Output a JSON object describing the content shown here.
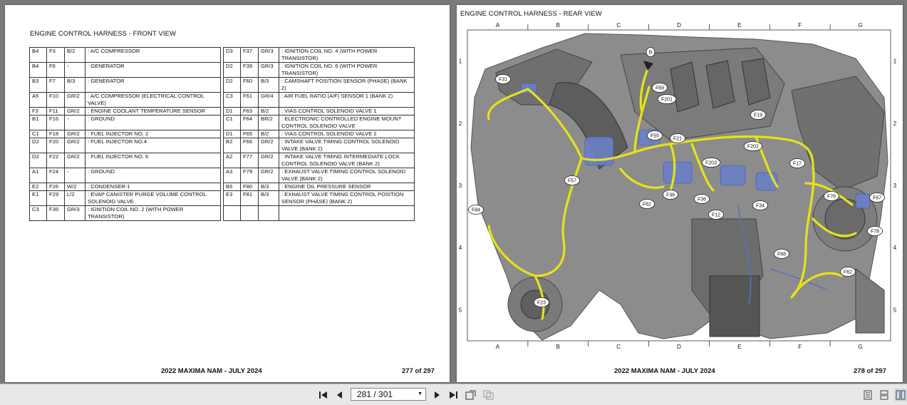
{
  "left_page": {
    "title": "ENGINE CONTROL HARNESS - FRONT VIEW",
    "footer_doc": "2022 MAXIMA NAM - JULY 2024",
    "footer_page": "277 of 297",
    "rows": [
      [
        [
          "B4",
          "F3",
          "B/2",
          ": A/C COMPRESSOR"
        ],
        [
          "D3",
          "F37",
          "GR/3",
          ": IGNITION COIL NO. 4 (WITH POWER TRANSISTOR)"
        ]
      ],
      [
        [
          "B4",
          "F6",
          "-",
          ": GENERATOR"
        ],
        [
          "D2",
          "F39",
          "GR/3",
          ": IGNITION COIL NO. 6 (WITH POWER TRANSISTOR)"
        ]
      ],
      [
        [
          "B3",
          "F7",
          "B/3",
          ": GENERATOR"
        ],
        [
          "D2",
          "F60",
          "B/3",
          ": CAMSHAFT POSITION SENSOR (PHASE) (BANK 2)"
        ]
      ],
      [
        [
          "A5",
          "F10",
          "GR/2",
          ": A/C COMPRESSOR (ELECTRICAL CONTROL VALVE)"
        ],
        [
          "C3",
          "F61",
          "GR/4",
          ": AIR FUEL RATIO (A/F) SENSOR 1 (BANK 2)"
        ]
      ],
      [
        [
          "F3",
          "F11",
          "GR/2",
          ": ENGINE COOLANT TEMPERATURE SENSOR"
        ],
        [
          "D1",
          "F63",
          "B/2",
          ": VIAS CONTROL SOLENOID VALVE 1"
        ]
      ],
      [
        [
          "B1",
          "F16",
          "-",
          ": GROUND"
        ],
        [
          "C1",
          "F64",
          "BR/2",
          ": ELECTRONIC CONTROLLED ENGINE MOUNT CONTROL SOLENOID VALVE"
        ]
      ],
      [
        [
          "C1",
          "F18",
          "GR/2",
          ": FUEL INJECTOR NO. 2"
        ],
        [
          "D1",
          "F65",
          "B/2",
          ": VIAS CONTROL SOLENOID VALVE 2"
        ]
      ],
      [
        [
          "D2",
          "F20",
          "GR/2",
          ": FUEL INJECTOR NO.4"
        ],
        [
          "B2",
          "F66",
          "GR/2",
          ": INTAKE VALVE TIMING CONTROL SOLENOID VALVE (BANK 2)"
        ]
      ],
      [
        [
          "D2",
          "F22",
          "GR/2",
          ": FUEL INJECTOR NO. 6"
        ],
        [
          "A2",
          "F77",
          "GR/2",
          ": INTAKE VALVE TIMING INTERMEDIATE LOCK CONTROL SOLENOID VALVE (BANK 2)"
        ]
      ],
      [
        [
          "A1",
          "F24",
          "-",
          ": GROUND"
        ],
        [
          "A3",
          "F79",
          "GR/2",
          ": EXHAUST VALVE TIMING CONTROL SOLENOID VALVE (BANK 2)"
        ]
      ],
      [
        [
          "E2",
          "F26",
          "W/2",
          ": CONDENSER-1"
        ],
        [
          "B5",
          "F80",
          "B/3",
          ": ENGINE OIL PRESSURE SENSOR"
        ]
      ],
      [
        [
          "E1",
          "F29",
          "L/2",
          ": EVAP CANISTER PURGE VOLUME CONTROL SOLENOID VALVE"
        ],
        [
          "E3",
          "F81",
          "B/3",
          ": EXHAUST VALVE TIMING CONTROL POSITION SENSOR (PHASE) (BANK 2)"
        ]
      ],
      [
        [
          "C3",
          "F35",
          "GR/3",
          ": IGNITION COIL NO. 2 (WITH POWER TRANSISTOR)"
        ],
        [
          "",
          "",
          "",
          ""
        ]
      ]
    ]
  },
  "right_page": {
    "title": "ENGINE CONTROL HARNESS - REAR VIEW",
    "footer_doc": "2022 MAXIMA NAM - JULY 2024",
    "footer_page": "278 of 297",
    "grid_cols": [
      "A",
      "B",
      "C",
      "D",
      "E",
      "F",
      "G"
    ],
    "grid_rows": [
      "1",
      "2",
      "3",
      "4",
      "5"
    ],
    "callouts": [
      "B",
      "F31",
      "F69",
      "F201",
      "F19",
      "F55",
      "F21",
      "F202",
      "F17",
      "F203",
      "F57",
      "F38",
      "F36",
      "F76",
      "F67",
      "F82",
      "F34",
      "F12",
      "F84",
      "F78",
      "F68",
      "F62",
      "F23"
    ]
  },
  "toolbar": {
    "page_value": "281 / 301",
    "icons": [
      "first-page-icon",
      "prev-page-icon",
      "next-page-icon",
      "last-page-icon",
      "rotate-icon",
      "copy-icon",
      "single-page-icon",
      "continuous-icon",
      "two-page-icon"
    ]
  },
  "colors": {
    "harness": "#e6e21a",
    "background": "#7a7a7a",
    "toolbar": "#e8e8e8"
  }
}
